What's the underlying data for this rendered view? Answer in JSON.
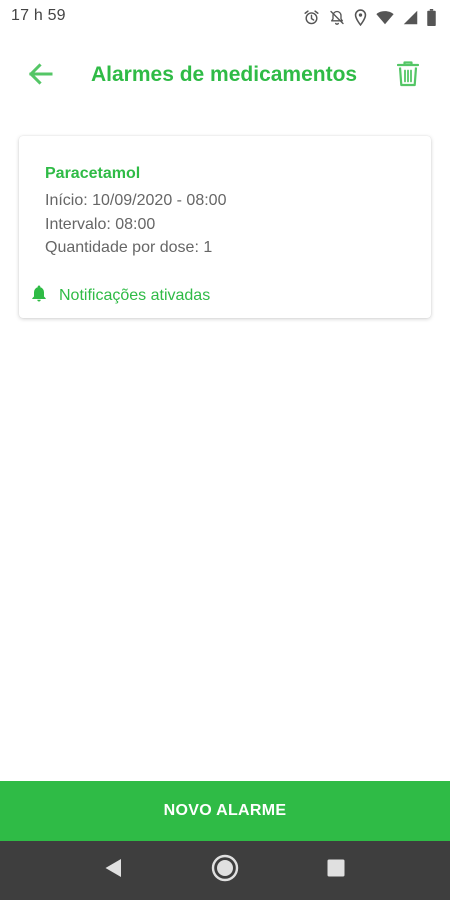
{
  "status_bar": {
    "time": "17 h 59",
    "icons": [
      "alarm-clock-icon",
      "notifications-off-icon",
      "location-icon",
      "wifi-icon",
      "cell-signal-icon",
      "battery-icon"
    ]
  },
  "toolbar": {
    "title": "Alarmes de medicamentos",
    "back_icon": "arrow-back-icon",
    "delete_icon": "trash-icon"
  },
  "alarms": [
    {
      "name": "Paracetamol",
      "start": "Início: 10/09/2020 - 08:00",
      "interval": "Intervalo: 08:00",
      "dose": "Quantidade por dose: 1",
      "notification_icon": "bell-icon",
      "notification_status": "Notificações ativadas"
    }
  ],
  "new_alarm_button": {
    "label": "NOVO ALARME"
  },
  "nav_bar": {
    "icons": [
      "back-triangle-icon",
      "home-circle-icon",
      "recents-square-icon"
    ]
  },
  "colors": {
    "accent": "#2fbb46",
    "nav_background": "#3e3e3e",
    "secondary_text": "#666666"
  }
}
